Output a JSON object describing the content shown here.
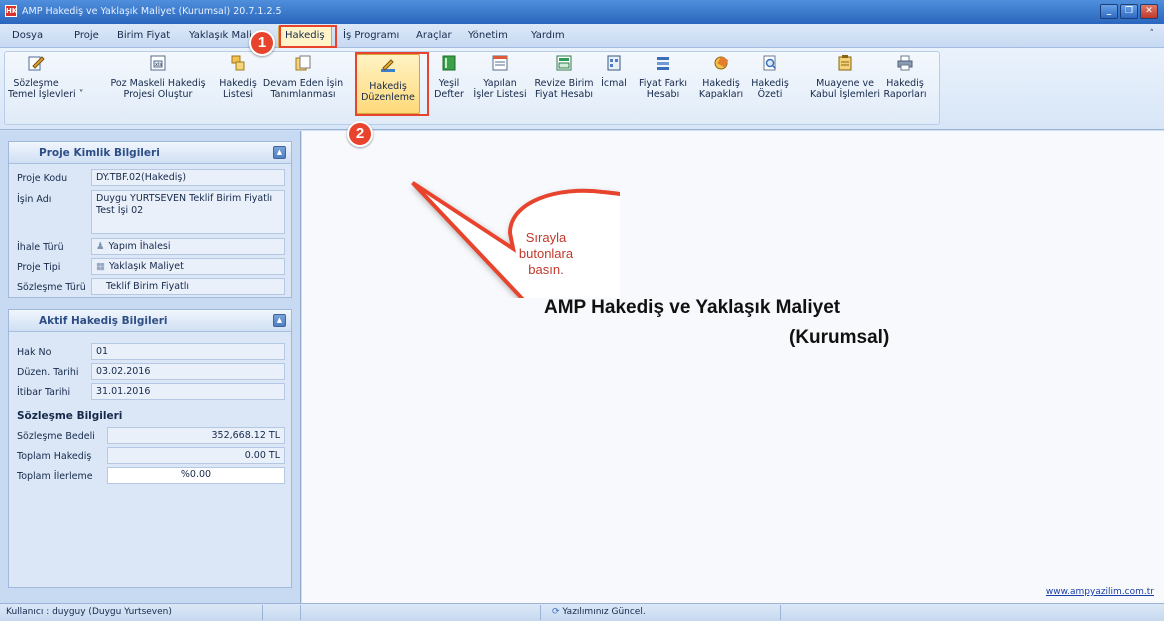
{
  "window": {
    "title": "AMP Hakediş ve Yaklaşık Maliyet (Kurumsal) 20.7.1.2.5",
    "app_icon_label": "HK",
    "controls": [
      "_",
      "❐",
      "✕"
    ]
  },
  "menu": {
    "items": [
      "Dosya",
      "Proje",
      "Birim Fiyat",
      "Yaklaşık Mali",
      "Hakediş",
      "İş Programı",
      "Araçlar",
      "Yönetim",
      "Yardım"
    ],
    "collapse_glyph": "˄"
  },
  "ribbon": {
    "buttons": [
      {
        "line1": "Sözleşme",
        "line2": "Temel İşlevleri ˅",
        "icon": "pencil-document-icon"
      },
      {
        "line1": "Poz Maskeli Hakediş",
        "line2": "Projesi Oluştur",
        "icon": "spreadsheet-icon"
      },
      {
        "line1": "Hakediş",
        "line2": "Listesi",
        "icon": "folders-icon"
      },
      {
        "line1": "Devam Eden İşin",
        "line2": "Tanımlanması",
        "icon": "documents-icon"
      },
      {
        "line1": "Hakediş",
        "line2": "Düzenleme",
        "icon": "edit-ruler-icon"
      },
      {
        "line1": "Yeşil",
        "line2": "Defter",
        "icon": "green-book-icon"
      },
      {
        "line1": "Yapılan",
        "line2": "İşler Listesi",
        "icon": "list-grid-icon"
      },
      {
        "line1": "Revize Birim",
        "line2": "Fiyat Hesabı",
        "icon": "calc-sheet-icon"
      },
      {
        "line1": "İcmal",
        "line2": "",
        "icon": "summary-icon"
      },
      {
        "line1": "Fiyat Farkı",
        "line2": "Hesabı",
        "icon": "price-diff-icon"
      },
      {
        "line1": "Hakediş",
        "line2": "Kapakları",
        "icon": "covers-icon"
      },
      {
        "line1": "Hakediş",
        "line2": "Özeti",
        "icon": "magnifier-doc-icon"
      },
      {
        "line1": "Muayene ve",
        "line2": "Kabul İşlemleri",
        "icon": "clipboard-icon"
      },
      {
        "line1": "Hakediş",
        "line2": "Raporları",
        "icon": "printer-icon"
      }
    ]
  },
  "project_panel": {
    "title": "Proje Kimlik Bilgileri",
    "proje_kodu_label": "Proje Kodu",
    "proje_kodu": "DY.TBF.02(Hakediş)",
    "isin_adi_label": "İşin Adı",
    "isin_adi": "Duygu YURTSEVEN Teklif Birim Fiyatlı Test İşi 02",
    "ihale_turu_label": "İhale Türü",
    "ihale_turu": "Yapım İhalesi",
    "proje_tipi_label": "Proje Tipi",
    "proje_tipi": "Yaklaşık Maliyet",
    "sozlesme_turu_label": "Sözleşme Türü",
    "sozlesme_turu": "Teklif Birim Fiyatlı"
  },
  "active_panel": {
    "title": "Aktif Hakediş Bilgileri",
    "hak_no_label": "Hak No",
    "hak_no": "01",
    "duzen_tarihi_label": "Düzen. Tarihi",
    "duzen_tarihi": "03.02.2016",
    "itibar_tarihi_label": "İtibar Tarihi",
    "itibar_tarihi": "31.01.2016",
    "section_title": "Sözleşme Bilgileri",
    "sozlesme_bedeli_label": "Sözleşme Bedeli",
    "sozlesme_bedeli": "352,668.12 TL",
    "toplam_hakedis_label": "Toplam Hakediş",
    "toplam_hakedis": "0.00 TL",
    "toplam_ilerleme_label": "Toplam İlerleme",
    "toplam_ilerleme": "%0.00",
    "progress_fraction": 0
  },
  "main": {
    "brand_line1": "AMP Hakediş ve Yaklaşık Maliyet",
    "brand_line2": "(Kurumsal)",
    "website": "www.ampyazilim.com.tr"
  },
  "annotations": {
    "badge1": "1",
    "badge2": "2",
    "speech_line1": "Sırayla",
    "speech_line2": "butonlara",
    "speech_line3": "basın.",
    "color": "#e8432c"
  },
  "status": {
    "user": "Kullanıcı : duyguy  (Duygu Yurtseven)",
    "update": "Yazılımınız Güncel."
  }
}
